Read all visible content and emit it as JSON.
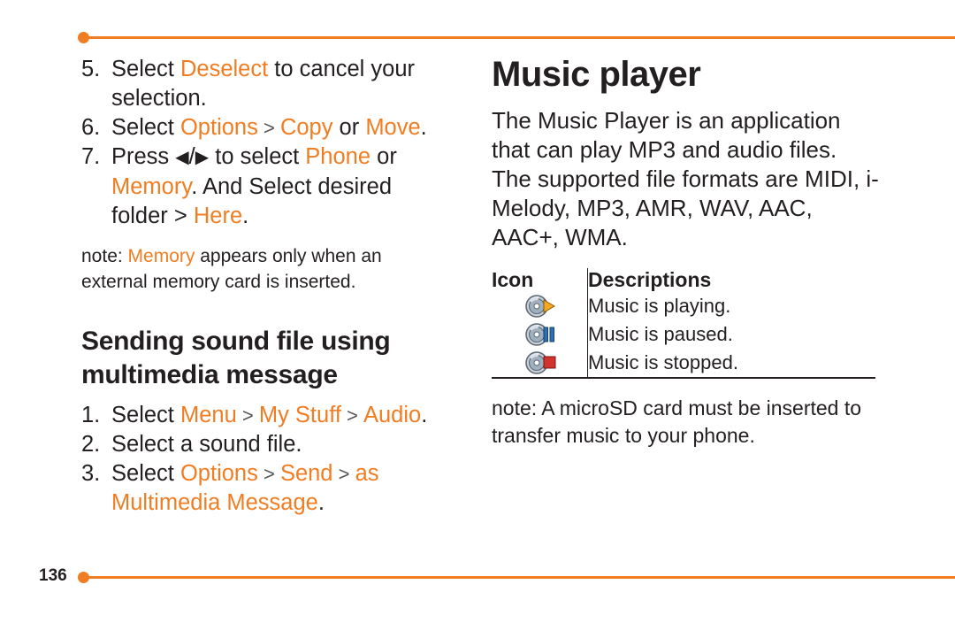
{
  "page": {
    "number": "136",
    "accent_color": "#f07d22",
    "text_color": "#231f20"
  },
  "left_column": {
    "steps": [
      {
        "num": "5.",
        "parts": [
          {
            "t": "Select ",
            "c": "dark"
          },
          {
            "t": "Deselect",
            "c": "orange"
          },
          {
            "t": " to cancel your selection.",
            "c": "dark"
          }
        ]
      },
      {
        "num": "6.",
        "parts": [
          {
            "t": "Select ",
            "c": "dark"
          },
          {
            "t": "Options",
            "c": "orange"
          },
          {
            "t": " > ",
            "c": "sep"
          },
          {
            "t": "Copy",
            "c": "orange"
          },
          {
            "t": " or ",
            "c": "dark"
          },
          {
            "t": "Move",
            "c": "orange"
          },
          {
            "t": ".",
            "c": "dark"
          }
        ]
      },
      {
        "num": "7.",
        "parts": [
          {
            "t": "Press ",
            "c": "dark"
          },
          {
            "t": "◀",
            "c": "dark"
          },
          {
            "t": "/",
            "c": "dark"
          },
          {
            "t": "▶",
            "c": "dark"
          },
          {
            "t": " to select ",
            "c": "dark"
          },
          {
            "t": "Phone",
            "c": "orange"
          },
          {
            "t": " or ",
            "c": "dark"
          },
          {
            "t": "Memory",
            "c": "orange"
          },
          {
            "t": ". And Select desired folder > ",
            "c": "dark"
          },
          {
            "t": "Here",
            "c": "orange"
          },
          {
            "t": ".",
            "c": "dark"
          }
        ]
      }
    ],
    "note": {
      "label": "note:",
      "parts": [
        {
          "t": "note: ",
          "c": "dark"
        },
        {
          "t": "Memory",
          "c": "orange"
        },
        {
          "t": " appears only when an external memory card is inserted.",
          "c": "dark"
        }
      ]
    },
    "subheading": "Sending sound file using multimedia message",
    "steps2": [
      {
        "num": "1.",
        "parts": [
          {
            "t": "Select ",
            "c": "dark"
          },
          {
            "t": "Menu",
            "c": "orange"
          },
          {
            "t": " > ",
            "c": "sep"
          },
          {
            "t": "My Stuff",
            "c": "orange"
          },
          {
            "t": " > ",
            "c": "sep"
          },
          {
            "t": "Audio",
            "c": "orange"
          },
          {
            "t": ".",
            "c": "dark"
          }
        ]
      },
      {
        "num": "2.",
        "parts": [
          {
            "t": "Select a sound file.",
            "c": "dark"
          }
        ]
      },
      {
        "num": "3.",
        "parts": [
          {
            "t": "Select ",
            "c": "dark"
          },
          {
            "t": "Options",
            "c": "orange"
          },
          {
            "t": " > ",
            "c": "sep"
          },
          {
            "t": "Send",
            "c": "orange"
          },
          {
            "t": " > ",
            "c": "sep"
          },
          {
            "t": "as Multimedia Message",
            "c": "orange"
          },
          {
            "t": ".",
            "c": "dark"
          }
        ]
      }
    ]
  },
  "right_column": {
    "title": "Music player",
    "intro": "The Music Player is an application that can play MP3 and audio files. The supported file formats are MIDI, i-Melody, MP3, AMR, WAV, AAC, AAC+, WMA.",
    "table": {
      "headers": [
        "Icon",
        "Descriptions"
      ],
      "rows": [
        {
          "icon": "cd-play-icon",
          "description": "Music is playing."
        },
        {
          "icon": "cd-pause-icon",
          "description": "Music is paused."
        },
        {
          "icon": "cd-stop-icon",
          "description": "Music is stopped."
        }
      ]
    },
    "note": "note: A microSD card must be inserted to transfer music to your phone.",
    "note_label": "note:"
  }
}
